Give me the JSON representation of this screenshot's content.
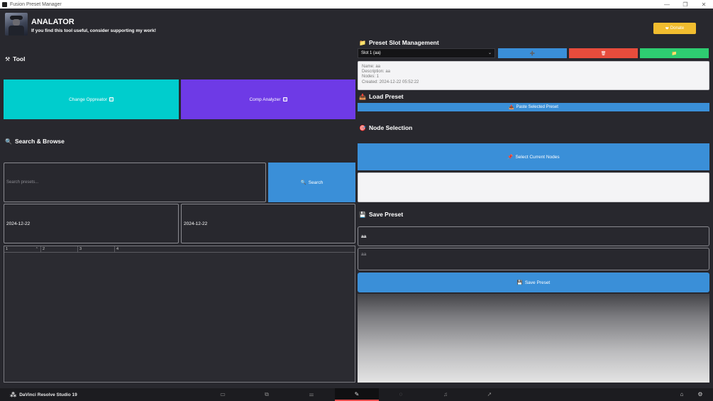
{
  "window": {
    "title": "Fusion Preset Manager",
    "controls": {
      "minimize": "—",
      "maximize": "❐",
      "close": "✕"
    }
  },
  "header": {
    "name": "ANALATOR",
    "subtitle": "If you find this tool useful, consider supporting my work!",
    "donate_label": "Donate",
    "donate_icon": "❤"
  },
  "tool": {
    "title": "Tool",
    "icon": "⚒",
    "change_operator_label": "Change Oppreator",
    "comp_analyzer_label": "Comp Analyzer",
    "colors": {
      "change_operator": "#00cdcd",
      "comp_analyzer": "#6e3ae6"
    }
  },
  "search": {
    "title": "Search & Browse",
    "icon": "🔍",
    "placeholder": "Search presets...",
    "button_label": "Search",
    "button_icon": "🔍",
    "date_from": "2024-12-22",
    "date_to": "2024-12-22",
    "columns": [
      "1",
      "2",
      "3",
      "4"
    ]
  },
  "slot": {
    "title": "Preset Slot Management",
    "icon": "📁",
    "selected": "Slot 1 (aa)",
    "add_icon": "➕",
    "delete_icon": "🗑",
    "folder_icon": "📁",
    "colors": {
      "add": "#3a8fd8",
      "delete": "#e74c3c",
      "folder": "#2ecc71"
    },
    "info": {
      "name": "Name: aa",
      "description": "Description: aa",
      "nodes": "Nodes: 1",
      "created": "Created: 2024-12-22 05:52:22"
    }
  },
  "load": {
    "title": "Load Preset",
    "icon": "📥",
    "paste_label": "Paste Selected Preset",
    "paste_icon": "📥"
  },
  "node": {
    "title": "Node Selection",
    "icon": "🎯",
    "select_label": "Select Current Nodes",
    "select_icon": "📌"
  },
  "save": {
    "title": "Save Preset",
    "icon": "💾",
    "name_value": "aa",
    "description_value": "aa",
    "save_label": "Save Preset",
    "save_icon": "💾"
  },
  "bottombar": {
    "brand": "DaVinci Resolve Studio 19",
    "pages": [
      "▭",
      "⧉",
      "⚌",
      "✎",
      "◌",
      "♫",
      "➚"
    ],
    "home_icon": "⌂",
    "settings_icon": "⚙"
  }
}
